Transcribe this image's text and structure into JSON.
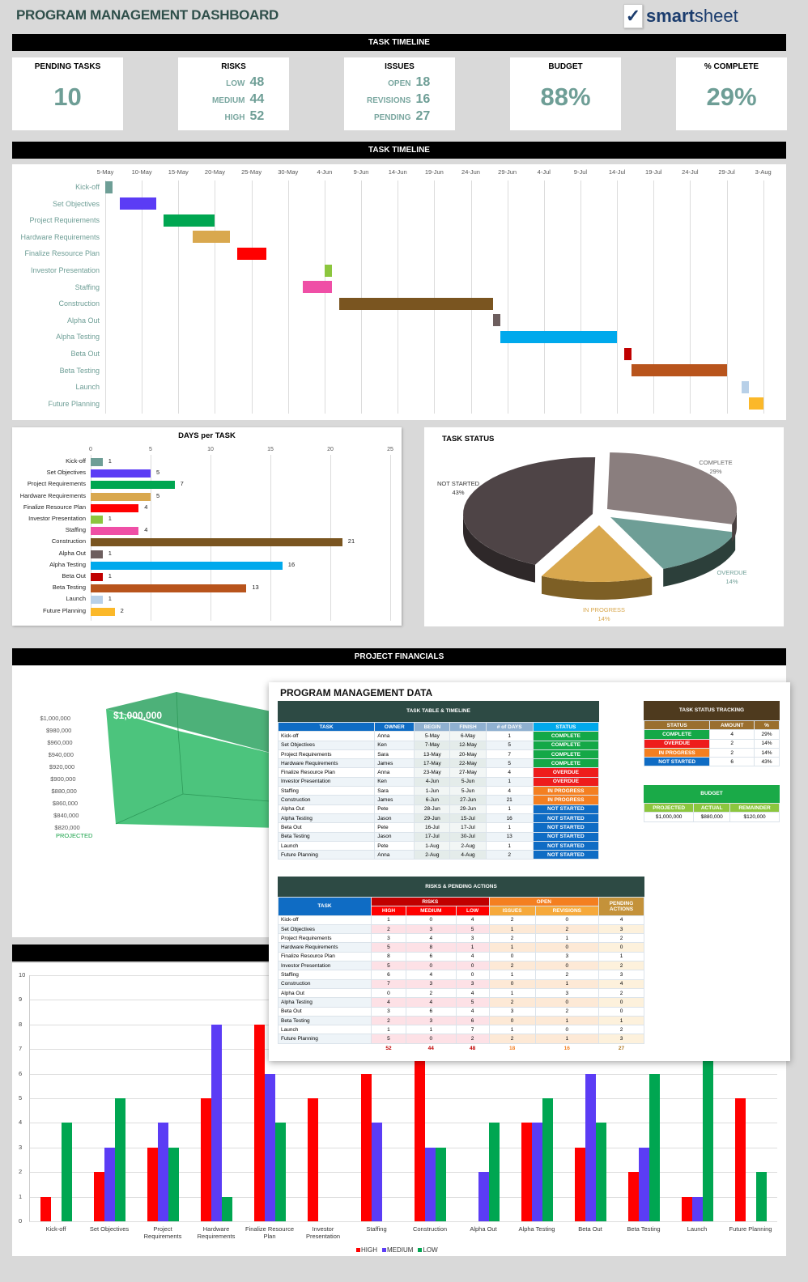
{
  "header": {
    "title": "PROGRAM MANAGEMENT DASHBOARD",
    "logo_brand_bold": "smart",
    "logo_brand_rest": "sheet",
    "logo_icon": "checkmark-icon"
  },
  "sections": {
    "top": "TASK TIMELINE",
    "timeline": "TASK TIMELINE",
    "financials": "PROJECT FINANCIALS",
    "risks_chart": ""
  },
  "kpis": {
    "pending": {
      "title": "PENDING TASKS",
      "value": "10"
    },
    "risks": {
      "title": "RISKS",
      "rows": [
        {
          "label": "LOW",
          "value": "48"
        },
        {
          "label": "MEDIUM",
          "value": "44"
        },
        {
          "label": "HIGH",
          "value": "52"
        }
      ]
    },
    "issues": {
      "title": "ISSUES",
      "rows": [
        {
          "label": "OPEN",
          "value": "18"
        },
        {
          "label": "REVISIONS",
          "value": "16"
        },
        {
          "label": "PENDING",
          "value": "27"
        }
      ]
    },
    "budget": {
      "title": "BUDGET",
      "value": "88%"
    },
    "complete": {
      "title": "% COMPLETE",
      "value": "29%"
    }
  },
  "tasks": [
    "Kick-off",
    "Set Objectives",
    "Project Requirements",
    "Hardware Requirements",
    "Finalize Resource Plan",
    "Investor Presentation",
    "Staffing",
    "Construction",
    "Alpha Out",
    "Alpha Testing",
    "Beta Out",
    "Beta Testing",
    "Launch",
    "Future Planning"
  ],
  "task_colors": [
    "#6e9e96",
    "#5b3cf5",
    "#00a651",
    "#d9a84e",
    "#ff0000",
    "#8cc63e",
    "#ef4fa6",
    "#7a5520",
    "#6d5e5e",
    "#00a9ec",
    "#c00000",
    "#b8541c",
    "#b8d0e8",
    "#fbb829"
  ],
  "chart_data": [
    {
      "type": "bar",
      "name": "gantt",
      "title": "TASK TIMELINE",
      "x_ticks": [
        "5-May",
        "10-May",
        "15-May",
        "20-May",
        "25-May",
        "30-May",
        "4-Jun",
        "9-Jun",
        "14-Jun",
        "19-Jun",
        "24-Jun",
        "29-Jun",
        "4-Jul",
        "9-Jul",
        "14-Jul",
        "19-Jul",
        "24-Jul",
        "29-Jul",
        "3-Aug"
      ],
      "categories": [
        "Kick-off",
        "Set Objectives",
        "Project Requirements",
        "Hardware Requirements",
        "Finalize Resource Plan",
        "Investor Presentation",
        "Staffing",
        "Construction",
        "Alpha Out",
        "Alpha Testing",
        "Beta Out",
        "Beta Testing",
        "Launch",
        "Future Planning"
      ],
      "start_day_offset": [
        0,
        2,
        8,
        12,
        18,
        30,
        27,
        32,
        53,
        54,
        71,
        72,
        87,
        88
      ],
      "duration_days": [
        1,
        5,
        7,
        5,
        4,
        1,
        4,
        21,
        1,
        16,
        1,
        13,
        1,
        2
      ]
    },
    {
      "type": "bar",
      "name": "days-per-task",
      "title": "DAYS per TASK",
      "categories": [
        "Kick-off",
        "Set Objectives",
        "Project Requirements",
        "Hardware Requirements",
        "Finalize Resource Plan",
        "Investor Presentation",
        "Staffing",
        "Construction",
        "Alpha Out",
        "Alpha Testing",
        "Beta Out",
        "Beta Testing",
        "Launch",
        "Future Planning"
      ],
      "values": [
        1,
        5,
        7,
        5,
        4,
        1,
        4,
        21,
        1,
        16,
        1,
        13,
        1,
        2
      ],
      "x_ticks": [
        "0",
        "5",
        "10",
        "15",
        "20",
        "25"
      ],
      "xlim": [
        0,
        25
      ]
    },
    {
      "type": "pie",
      "name": "task-status",
      "title": "TASK STATUS",
      "slices": [
        {
          "label": "COMPLETE",
          "value": 29,
          "pct": "29%",
          "color": "#8a7e7e"
        },
        {
          "label": "OVERDUE",
          "value": 14,
          "pct": "14%",
          "color": "#6e9e96"
        },
        {
          "label": "IN PROGRESS",
          "value": 14,
          "pct": "14%",
          "color": "#d9a84e"
        },
        {
          "label": "NOT STARTED",
          "value": 43,
          "pct": "43%",
          "color": "#4e4446"
        }
      ]
    },
    {
      "type": "bar",
      "name": "budget-3d",
      "categories": [
        "PROJECTED"
      ],
      "values": [
        1000000
      ],
      "data_label": "$1,000,000",
      "y_ticks": [
        "$1,000,000",
        "$980,000",
        "$960,000",
        "$940,000",
        "$920,000",
        "$900,000",
        "$880,000",
        "$860,000",
        "$840,000",
        "$820,000"
      ],
      "ylim": [
        820000,
        1000000
      ]
    },
    {
      "type": "bar",
      "name": "risks-by-task",
      "categories": [
        "Kick-off",
        "Set Objectives",
        "Project Requirements",
        "Hardware Requirements",
        "Finalize Resource Plan",
        "Investor Presentation",
        "Staffing",
        "Construction",
        "Alpha Out",
        "Alpha Testing",
        "Beta Out",
        "Beta Testing",
        "Launch",
        "Future Planning"
      ],
      "x_labels": [
        [
          "Kick-off"
        ],
        [
          "Set Objectives"
        ],
        [
          "Project",
          "Requirements"
        ],
        [
          "Hardware",
          "Requirements"
        ],
        [
          "Finalize Resource",
          "Plan"
        ],
        [
          "Investor",
          "Presentation"
        ],
        [
          "Staffing"
        ],
        [
          "Construction"
        ],
        [
          "Alpha Out"
        ],
        [
          "Alpha Testing"
        ],
        [
          "Beta Out"
        ],
        [
          "Beta Testing"
        ],
        [
          "Launch"
        ],
        [
          "Future Planning"
        ]
      ],
      "series": [
        {
          "name": "HIGH",
          "color": "#ff0000",
          "values": [
            1,
            2,
            3,
            5,
            8,
            5,
            6,
            7,
            0,
            4,
            3,
            2,
            1,
            5
          ]
        },
        {
          "name": "MEDIUM",
          "color": "#5b3cf5",
          "values": [
            0,
            3,
            4,
            8,
            6,
            0,
            4,
            3,
            2,
            4,
            6,
            3,
            1,
            0
          ]
        },
        {
          "name": "LOW",
          "color": "#00a651",
          "values": [
            4,
            5,
            3,
            1,
            4,
            0,
            0,
            3,
            4,
            5,
            4,
            6,
            7,
            2
          ]
        }
      ],
      "y_ticks": [
        "0",
        "1",
        "2",
        "3",
        "4",
        "5",
        "6",
        "7",
        "8",
        "9",
        "10"
      ],
      "ylim": [
        0,
        10
      ],
      "legend": "bottom-center"
    }
  ],
  "pm_data": {
    "title": "PROGRAM MANAGEMENT DATA",
    "task_table": {
      "title": "TASK TABLE & TIMELINE",
      "headers": [
        "TASK",
        "OWNER",
        "BEGIN",
        "FINISH",
        "# of DAYS",
        "STATUS"
      ],
      "rows": [
        [
          "Kick-off",
          "Anna",
          "5-May",
          "6-May",
          "1",
          "COMPLETE"
        ],
        [
          "Set Objectives",
          "Ken",
          "7-May",
          "12-May",
          "5",
          "COMPLETE"
        ],
        [
          "Project Requirements",
          "Sara",
          "13-May",
          "20-May",
          "7",
          "COMPLETE"
        ],
        [
          "Hardware Requirements",
          "James",
          "17-May",
          "22-May",
          "5",
          "COMPLETE"
        ],
        [
          "Finalize Resource Plan",
          "Anna",
          "23-May",
          "27-May",
          "4",
          "OVERDUE"
        ],
        [
          "Investor Presentation",
          "Ken",
          "4-Jun",
          "5-Jun",
          "1",
          "OVERDUE"
        ],
        [
          "Staffing",
          "Sara",
          "1-Jun",
          "5-Jun",
          "4",
          "IN PROGRESS"
        ],
        [
          "Construction",
          "James",
          "6-Jun",
          "27-Jun",
          "21",
          "IN PROGRESS"
        ],
        [
          "Alpha Out",
          "Pete",
          "28-Jun",
          "29-Jun",
          "1",
          "NOT STARTED"
        ],
        [
          "Alpha Testing",
          "Jason",
          "29-Jun",
          "15-Jul",
          "16",
          "NOT STARTED"
        ],
        [
          "Beta Out",
          "Pete",
          "16-Jul",
          "17-Jul",
          "1",
          "NOT STARTED"
        ],
        [
          "Beta Testing",
          "Jason",
          "17-Jul",
          "30-Jul",
          "13",
          "NOT STARTED"
        ],
        [
          "Launch",
          "Pete",
          "1-Aug",
          "2-Aug",
          "1",
          "NOT STARTED"
        ],
        [
          "Future Planning",
          "Anna",
          "2-Aug",
          "4-Aug",
          "2",
          "NOT STARTED"
        ]
      ]
    },
    "status_colors": {
      "COMPLETE": "#14a847",
      "OVERDUE": "#ee1c1c",
      "IN PROGRESS": "#f47f20",
      "NOT STARTED": "#0f6cc4"
    },
    "status_tracking": {
      "title": "TASK STATUS TRACKING",
      "headers": [
        "STATUS",
        "AMOUNT",
        "%"
      ],
      "rows": [
        [
          "COMPLETE",
          "4",
          "29%"
        ],
        [
          "OVERDUE",
          "2",
          "14%"
        ],
        [
          "IN PROGRESS",
          "2",
          "14%"
        ],
        [
          "NOT STARTED",
          "6",
          "43%"
        ]
      ]
    },
    "budget": {
      "title": "BUDGET",
      "headers": [
        "PROJECTED",
        "ACTUAL",
        "REMAINDER"
      ],
      "values": [
        "$1,000,000",
        "$880,000",
        "$120,000"
      ]
    },
    "risks_table": {
      "title": "RISKS & PENDING ACTIONS",
      "task_header": "TASK",
      "risks_header": "RISKS",
      "open_header": "OPEN",
      "pending_header": "PENDING ACTIONS",
      "sub_headers": [
        "HIGH",
        "MEDIUM",
        "LOW",
        "ISSUES",
        "REVISIONS"
      ],
      "rows": [
        [
          "Kick-off",
          "1",
          "0",
          "4",
          "2",
          "0",
          "4"
        ],
        [
          "Set Objectives",
          "2",
          "3",
          "5",
          "1",
          "2",
          "3"
        ],
        [
          "Project Requirements",
          "3",
          "4",
          "3",
          "2",
          "1",
          "2"
        ],
        [
          "Hardware Requirements",
          "5",
          "8",
          "1",
          "1",
          "0",
          "0"
        ],
        [
          "Finalize Resource Plan",
          "8",
          "6",
          "4",
          "0",
          "3",
          "1"
        ],
        [
          "Investor Presentation",
          "5",
          "0",
          "0",
          "2",
          "0",
          "2"
        ],
        [
          "Staffing",
          "6",
          "4",
          "0",
          "1",
          "2",
          "3"
        ],
        [
          "Construction",
          "7",
          "3",
          "3",
          "0",
          "1",
          "4"
        ],
        [
          "Alpha Out",
          "0",
          "2",
          "4",
          "1",
          "3",
          "2"
        ],
        [
          "Alpha Testing",
          "4",
          "4",
          "5",
          "2",
          "0",
          "0"
        ],
        [
          "Beta Out",
          "3",
          "6",
          "4",
          "3",
          "2",
          "0"
        ],
        [
          "Beta Testing",
          "2",
          "3",
          "6",
          "0",
          "1",
          "1"
        ],
        [
          "Launch",
          "1",
          "1",
          "7",
          "1",
          "0",
          "2"
        ],
        [
          "Future Planning",
          "5",
          "0",
          "2",
          "2",
          "1",
          "3"
        ]
      ],
      "totals": [
        "52",
        "44",
        "48",
        "18",
        "16",
        "27"
      ]
    }
  }
}
